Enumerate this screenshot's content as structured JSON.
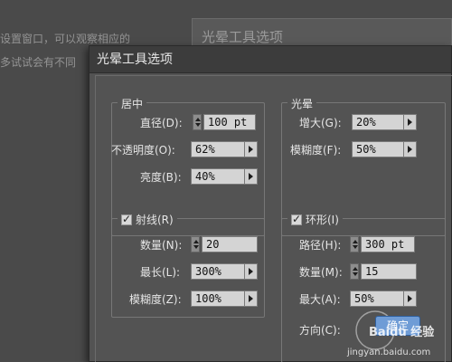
{
  "background": {
    "line1": "设置窗口，可以观察相应的",
    "line2": "多试试会有不同",
    "panel_title": "光晕工具选项"
  },
  "dialog": {
    "title": "光晕工具选项",
    "center": {
      "legend": "居中",
      "diameter": {
        "label": "直径(D):",
        "value": "100 pt"
      },
      "opacity": {
        "label": "不透明度(O):",
        "value": "62%"
      },
      "brightness": {
        "label": "亮度(B):",
        "value": "40%"
      }
    },
    "halo": {
      "legend": "光晕",
      "growth": {
        "label": "增大(G):",
        "value": "20%"
      },
      "fuzziness": {
        "label": "模糊度(F):",
        "value": "50%"
      }
    },
    "rays": {
      "legend": "射线(R)",
      "checked": true,
      "number": {
        "label": "数量(N):",
        "value": "20"
      },
      "longest": {
        "label": "最长(L):",
        "value": "300%"
      },
      "fuzziness": {
        "label": "模糊度(Z):",
        "value": "100%"
      }
    },
    "rings": {
      "legend": "环形(I)",
      "checked": true,
      "path": {
        "label": "路径(H):",
        "value": "300 pt"
      },
      "number": {
        "label": "数量(M):",
        "value": "15"
      },
      "largest": {
        "label": "最大(A):",
        "value": "50%"
      },
      "direction": {
        "label": "方向(C):"
      }
    },
    "ok_label": "确定"
  },
  "watermark": {
    "text": "Baidu 经验",
    "url": "jingyan.baidu.com"
  }
}
